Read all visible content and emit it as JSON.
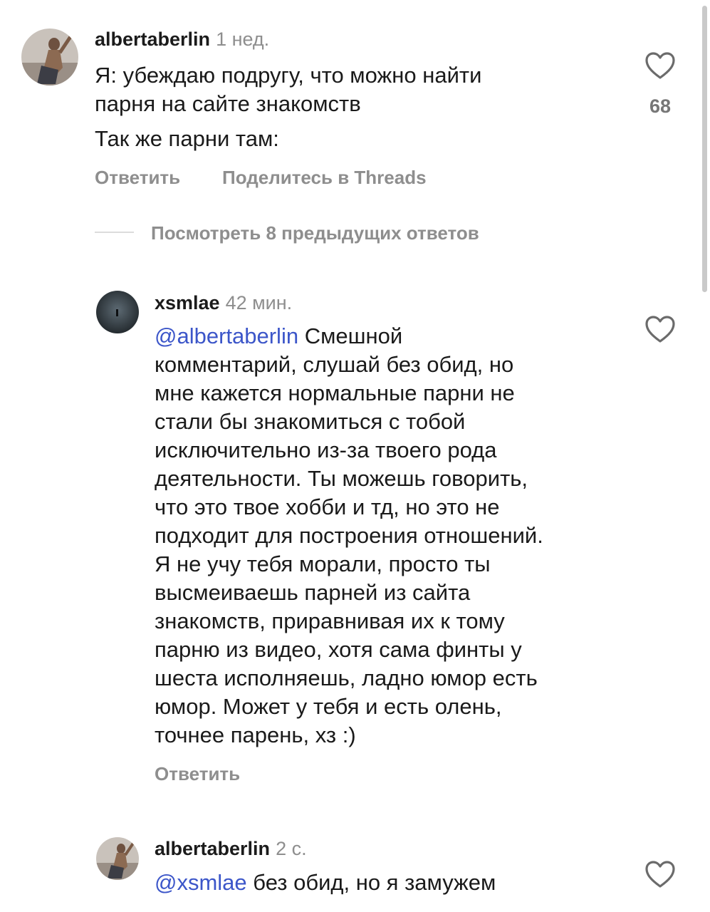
{
  "comments": [
    {
      "username": "albertaberlin",
      "time": "1 нед.",
      "text_lines": [
        "Я: убеждаю подругу, что можно найти",
        "парня на сайте знакомств"
      ],
      "text_extra": "Так же парни там:",
      "likes": "68",
      "actions": {
        "reply": "Ответить",
        "share": "Поделитесь в Threads"
      }
    },
    {
      "username": "xsmlae",
      "time": "42 мин.",
      "mention": "@albertaberlin",
      "text_first": " Смешной",
      "text_lines": [
        "комментарий, слушай без обид, но",
        "мне кажется нормальные парни не",
        "стали бы знакомиться с тобой",
        "исключительно из-за твоего рода",
        "деятельности. Ты можешь говорить,",
        "что это твое хобби и тд, но это не",
        "подходит для построения отношений.",
        "Я не учу тебя морали, просто ты",
        "высмеиваешь парней из сайта",
        "знакомств, приравнивая их к тому",
        "парню из видео, хотя сама финты у",
        "шеста исполняешь, ладно юмор есть",
        "юмор. Может у тебя и есть олень,",
        "точнее парень, хз :)"
      ],
      "actions": {
        "reply": "Ответить"
      }
    },
    {
      "username": "albertaberlin",
      "time": "2 с.",
      "mention": "@xsmlae",
      "text": " без обид, но я замужем"
    }
  ],
  "view_replies": "Посмотреть 8 предыдущих ответов",
  "colors": {
    "mention": "#3c56c9",
    "muted": "#8e8e8e"
  }
}
